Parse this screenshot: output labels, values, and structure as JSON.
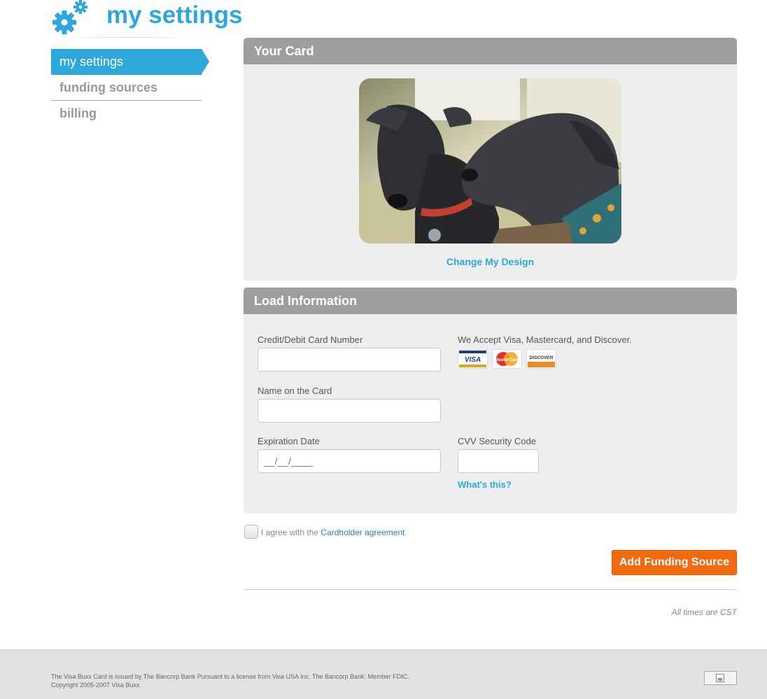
{
  "header": {
    "title": "my settings",
    "logo_icon": "gears-icon"
  },
  "sidebar": {
    "items": [
      {
        "label": "my settings"
      },
      {
        "label": "funding sources"
      },
      {
        "label": "billing"
      }
    ]
  },
  "card_panel": {
    "heading": "Your Card",
    "image": "two-greyhound-dogs-photo",
    "change_link": "Change My Design"
  },
  "load_panel": {
    "heading": "Load Information",
    "card_number_label": "Credit/Debit Card Number",
    "accepted_text": "We Accept Visa, Mastercard, and Discover.",
    "card_brands": [
      "VISA",
      "MasterCard",
      "DISCOVER"
    ],
    "name_label": "Name on the Card",
    "expiration_label": "Expiration Date",
    "expiration_value": "__/__/____",
    "cvv_label": "CVV Security Code",
    "whats_this": "What's this?"
  },
  "agreement": {
    "prefix": "I agree with the",
    "link": "Cardholder agreement"
  },
  "actions": {
    "add_button": "Add Funding Source"
  },
  "times_note": "All times are CST",
  "footer": {
    "line1": "The Visa Buxx Card is issued by The Bancorp Bank Pursuant to a license from Visa USA Inc. The Bancorp Bank: Member FDIC.",
    "line2": "Copyright 2005-2007 Visa Buxx"
  },
  "colors": {
    "accent": "#2ea8dc",
    "button": "#f26a10",
    "panel_header": "#9e9e9e",
    "panel_bg": "#eeeeee"
  }
}
